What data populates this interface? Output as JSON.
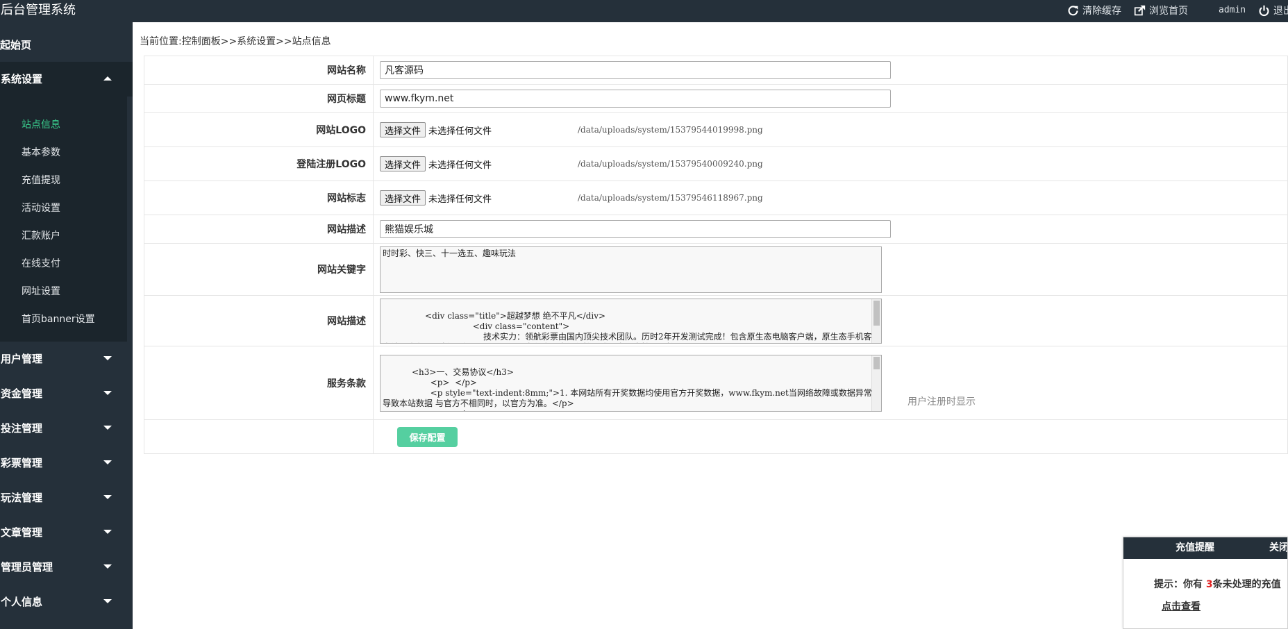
{
  "header": {
    "title": "后台管理系统",
    "clear_cache": "清除缓存",
    "browse_home": "浏览首页",
    "user": "admin",
    "logout": "退出"
  },
  "sidebar": {
    "home": "起始页",
    "groups": [
      {
        "label": "系统设置",
        "expanded": true,
        "items": [
          {
            "label": "站点信息",
            "active": true
          },
          {
            "label": "基本参数"
          },
          {
            "label": "充值提现"
          },
          {
            "label": "活动设置"
          },
          {
            "label": "汇款账户"
          },
          {
            "label": "在线支付"
          },
          {
            "label": "网址设置"
          },
          {
            "label": "首页banner设置"
          }
        ]
      },
      {
        "label": "用户管理"
      },
      {
        "label": "资金管理"
      },
      {
        "label": "投注管理"
      },
      {
        "label": "彩票管理"
      },
      {
        "label": "玩法管理"
      },
      {
        "label": "文章管理"
      },
      {
        "label": "管理员管理"
      },
      {
        "label": "个人信息"
      }
    ]
  },
  "breadcrumb": "当前位置:控制面板>>系统设置>>站点信息",
  "form": {
    "site_name": {
      "label": "网站名称",
      "value": "凡客源码"
    },
    "page_title": {
      "label": "网页标题",
      "value": "www.fkym.net"
    },
    "site_logo": {
      "label": "网站LOGO",
      "button": "选择文件",
      "status": "未选择任何文件",
      "path": "/data/uploads/system/15379544019998.png"
    },
    "login_logo": {
      "label": "登陆注册LOGO",
      "button": "选择文件",
      "status": "未选择任何文件",
      "path": "/data/uploads/system/15379540009240.png"
    },
    "site_mark": {
      "label": "网站标志",
      "button": "选择文件",
      "status": "未选择任何文件",
      "path": "/data/uploads/system/15379546118967.png"
    },
    "site_desc": {
      "label": "网站描述",
      "value": "熊猫娱乐城"
    },
    "keywords": {
      "label": "网站关键字",
      "value": "时时彩、快三、十一选五、趣味玩法"
    },
    "description_html": {
      "label": "网站描述",
      "value": "        <div class=\"title\">超越梦想 绝不平凡</div>\n                                  <div class=\"content\">\n                                      技术实力：领航彩票由国内顶尖技术团队。历时2年开发测试完成！包含原生态电脑客户端，原生态手机客户端，豪华网页版！采用Javascript开发程序，全组件接口式开发，支持无限扩展，"
    },
    "terms": {
      "label": "服务条款",
      "value": "   <h3>一、交易协议</h3>\n                  <p>  </p>\n                  <p style=\"text-indent:8mm;\">1. 本网站所有开奖数据均使用官方开奖数据，www.fkym.net当网络故障或数据异常导致本站数据 与官方不相同时，以官方为准。</p>\n                  <p>  </p>",
      "hint": "用户注册时显示"
    },
    "save_button": "保存配置"
  },
  "popup": {
    "title": "充值提醒",
    "close": "关闭",
    "message_prefix": "提示：你有 ",
    "count": "3",
    "message_suffix": "条未处理的充值",
    "link": "点击查看"
  }
}
